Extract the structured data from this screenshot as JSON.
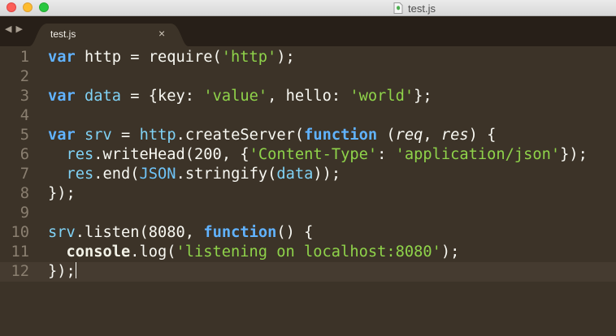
{
  "window": {
    "title": "test.js",
    "colors": {
      "background": "#3c3328",
      "keyword": "#61b3ff",
      "string": "#8fd34a",
      "variable": "#80d2f5"
    }
  },
  "tabbar": {
    "nav_arrows": "◀ ▶",
    "tabs": [
      {
        "label": "test.js",
        "close": "×",
        "active": true
      }
    ]
  },
  "editor": {
    "current_line": 12,
    "lines": [
      {
        "num": "1",
        "tokens": [
          {
            "t": "var",
            "c": "kw"
          },
          {
            "t": " http = require(",
            "c": "fn"
          },
          {
            "t": "'http'",
            "c": "str"
          },
          {
            "t": ");",
            "c": "fn"
          }
        ]
      },
      {
        "num": "2",
        "tokens": []
      },
      {
        "num": "3",
        "tokens": [
          {
            "t": "var",
            "c": "kw"
          },
          {
            "t": " ",
            "c": "fn"
          },
          {
            "t": "data",
            "c": "var"
          },
          {
            "t": " = {key: ",
            "c": "fn"
          },
          {
            "t": "'value'",
            "c": "str"
          },
          {
            "t": ", hello: ",
            "c": "fn"
          },
          {
            "t": "'world'",
            "c": "str"
          },
          {
            "t": "};",
            "c": "fn"
          }
        ]
      },
      {
        "num": "4",
        "tokens": []
      },
      {
        "num": "5",
        "tokens": [
          {
            "t": "var",
            "c": "kw"
          },
          {
            "t": " ",
            "c": "fn"
          },
          {
            "t": "srv",
            "c": "var"
          },
          {
            "t": " = ",
            "c": "fn"
          },
          {
            "t": "http",
            "c": "var"
          },
          {
            "t": ".createServer(",
            "c": "fn"
          },
          {
            "t": "function",
            "c": "kw"
          },
          {
            "t": " (",
            "c": "fn"
          },
          {
            "t": "req",
            "c": "param"
          },
          {
            "t": ", ",
            "c": "fn"
          },
          {
            "t": "res",
            "c": "param"
          },
          {
            "t": ") {",
            "c": "fn"
          }
        ]
      },
      {
        "num": "6",
        "tokens": [
          {
            "t": "  ",
            "c": "fn"
          },
          {
            "t": "res",
            "c": "var"
          },
          {
            "t": ".writeHead(",
            "c": "fn"
          },
          {
            "t": "200",
            "c": "num"
          },
          {
            "t": ", {",
            "c": "fn"
          },
          {
            "t": "'Content-Type'",
            "c": "str"
          },
          {
            "t": ": ",
            "c": "fn"
          },
          {
            "t": "'application/json'",
            "c": "str"
          },
          {
            "t": "});",
            "c": "fn"
          }
        ]
      },
      {
        "num": "7",
        "tokens": [
          {
            "t": "  ",
            "c": "fn"
          },
          {
            "t": "res",
            "c": "var"
          },
          {
            "t": ".end(",
            "c": "fn"
          },
          {
            "t": "JSON",
            "c": "bi"
          },
          {
            "t": ".stringify(",
            "c": "fn"
          },
          {
            "t": "data",
            "c": "var"
          },
          {
            "t": "));",
            "c": "fn"
          }
        ]
      },
      {
        "num": "8",
        "tokens": [
          {
            "t": "});",
            "c": "fn"
          }
        ]
      },
      {
        "num": "9",
        "tokens": []
      },
      {
        "num": "10",
        "tokens": [
          {
            "t": "srv",
            "c": "var"
          },
          {
            "t": ".listen(",
            "c": "fn"
          },
          {
            "t": "8080",
            "c": "num"
          },
          {
            "t": ", ",
            "c": "fn"
          },
          {
            "t": "function",
            "c": "kw"
          },
          {
            "t": "() {",
            "c": "fn"
          }
        ]
      },
      {
        "num": "11",
        "tokens": [
          {
            "t": "  ",
            "c": "fn"
          },
          {
            "t": "console",
            "c": "lib"
          },
          {
            "t": ".log(",
            "c": "fn"
          },
          {
            "t": "'listening on localhost:8080'",
            "c": "str"
          },
          {
            "t": ");",
            "c": "fn"
          }
        ]
      },
      {
        "num": "12",
        "tokens": [
          {
            "t": "});",
            "c": "fn"
          }
        ]
      }
    ]
  }
}
